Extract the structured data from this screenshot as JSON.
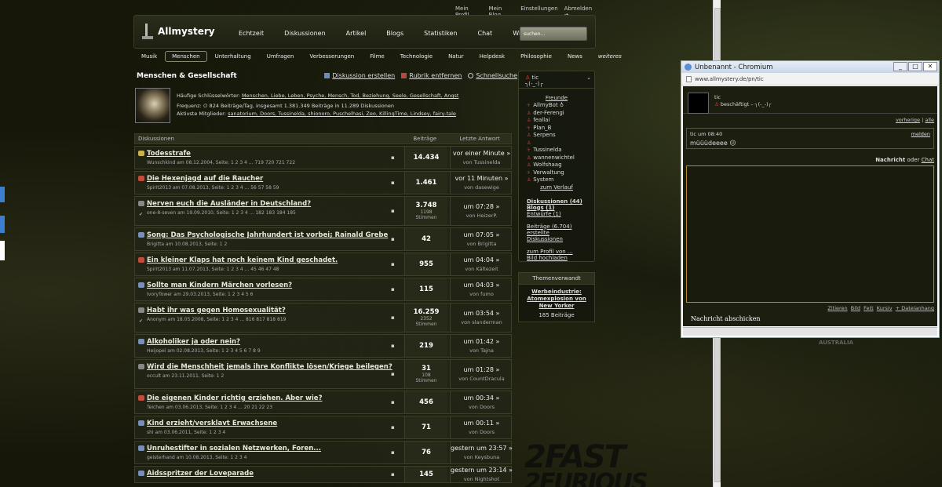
{
  "topnav": [
    "Mein Profil",
    "Mein Blog",
    "Einstellungen",
    "Abmelden ➔"
  ],
  "logo": "Allmystery",
  "mainnav": [
    "Echtzeit",
    "Diskussionen",
    "Artikel",
    "Blogs",
    "Statistiken",
    "Chat",
    "Wiki"
  ],
  "search_placeholder": "suchen...",
  "subnav": [
    "Musik",
    "Menschen",
    "Unterhaltung",
    "Umfragen",
    "Verbesserungen",
    "Filme",
    "Technologie",
    "Natur",
    "Helpdesk",
    "Philosophie",
    "News",
    "weiteres"
  ],
  "page": {
    "title": "Menschen & Gesellschaft",
    "action_create": "Diskussion erstellen",
    "action_remove": "Rubrik entfernen",
    "action_search": "Schnellsuche"
  },
  "info": {
    "keywords_label": "Häufige Schlüsselwörter:",
    "keywords": "Menschen, Liebe, Leben, Psyche, Mensch, Tod, Beziehung, Seele, Gesellschaft, Angst",
    "frequency": "Frequenz: ∅ 824 Beiträge/Tag, insgesamt 1.381.349 Beiträge in 11.289 Diskussionen",
    "members_label": "Aktivste Mitglieder:",
    "members": "sanatorium, Doors, Tussinelda, shionoro, Puschelhasi, Zeo, KillingTime, Lindsey, fairy-tale"
  },
  "table": {
    "col_discussions": "Diskussionen",
    "col_posts": "Beiträge",
    "col_last": "Letzte Antwort",
    "rows": [
      {
        "title": "Todesstrafe",
        "meta": "Wunschkind am 08.12.2004, Seite: 1 2 3 4 ... 719 720 721 722",
        "count": "14.434",
        "votes": "",
        "time": "vor einer Minute »",
        "by": "von Tussinelda",
        "icon": "yellow",
        "poll": false
      },
      {
        "title": "Die Hexenjagd auf die Raucher",
        "meta": "Spirit2013 am 07.08.2013, Seite: 1 2 3 4 ... 56 57 58 59",
        "count": "1.461",
        "votes": "",
        "time": "vor 11 Minuten »",
        "by": "von dasewige",
        "icon": "red",
        "poll": false
      },
      {
        "title": "Nerven euch die Ausländer in Deutschland?",
        "meta": "one-8-seven am 19.09.2010, Seite: 1 2 3 4 ... 182 183 184 185",
        "count": "3.748",
        "votes": "1198",
        "votes_label": "Stimmen",
        "time": "um 07:28 »",
        "by": "von HeizerP.",
        "icon": "poll",
        "poll": true
      },
      {
        "title": "Song: Das Psychologische Jahrhundert ist vorbei; Rainald Grebe",
        "meta": "Brigitta am 10.08.2013, Seite: 1 2",
        "count": "42",
        "votes": "",
        "time": "um 07:05 »",
        "by": "von Brigitta",
        "icon": "blue",
        "poll": false
      },
      {
        "title": "Ein kleiner Klaps hat noch keinem Kind geschadet.",
        "meta": "Spirit2013 am 11.07.2013, Seite: 1 2 3 4 ... 45 46 47 48",
        "count": "955",
        "votes": "",
        "time": "um 04:04 »",
        "by": "von Kältezeit",
        "icon": "red",
        "poll": false
      },
      {
        "title": "Sollte man Kindern Märchen vorlesen?",
        "meta": "IvoryTower am 29.03.2013, Seite: 1 2 3 4 5 6",
        "count": "115",
        "votes": "",
        "time": "um 04:03 »",
        "by": "von fumo",
        "icon": "blue",
        "poll": false
      },
      {
        "title": "Habt ihr was gegen Homosexualität?",
        "meta": "Anonym am 18.05.2008, Seite: 1 2 3 4 ... 816 817 818 819",
        "count": "16.259",
        "votes": "2352",
        "votes_label": "Stimmen",
        "time": "um 03:54 »",
        "by": "von slanderman",
        "icon": "poll",
        "poll": true
      },
      {
        "title": "Alkoholiker ja oder nein?",
        "meta": "Heijopei am 02.08.2013, Seite: 1 2 3 4 5 6 7 8 9",
        "count": "219",
        "votes": "",
        "time": "um 01:42 »",
        "by": "von Tajna",
        "icon": "blue",
        "poll": false
      },
      {
        "title": "Wird die Menschheit jemals ihre Konflikte lösen/Kriege beilegen?",
        "meta": "occult am 23.11.2011, Seite: 1 2",
        "count": "31",
        "votes": "108",
        "votes_label": "Stimmen",
        "time": "um 01:28 »",
        "by": "von CountDracula",
        "icon": "poll",
        "poll": false
      },
      {
        "title": "Die eigenen Kinder richtig erziehen. Aber wie?",
        "meta": "Teichen am 03.06.2013, Seite: 1 2 3 4 ... 20 21 22 23",
        "count": "456",
        "votes": "",
        "time": "um 00:34 »",
        "by": "von Doors",
        "icon": "red",
        "poll": false
      },
      {
        "title": "Kind erzieht/versklavt Erwachsene",
        "meta": "shi am 03.06.2011, Seite: 1 2 3 4",
        "count": "71",
        "votes": "",
        "time": "um 00:11 »",
        "by": "von Doors",
        "icon": "blue",
        "poll": false
      },
      {
        "title": "Unruhestifter in sozialen Netzwerken, Foren...",
        "meta": "geisterhand am 10.08.2013, Seite: 1 2 3 4",
        "count": "76",
        "votes": "",
        "time": "gestern um 23:57 »",
        "by": "von Keysbuna",
        "icon": "blue",
        "poll": false
      },
      {
        "title": "Aidsspritzer der Loveparade",
        "meta": "",
        "count": "145",
        "votes": "",
        "time": "gestern um 23:14 »",
        "by": "von Nightshot",
        "icon": "blue",
        "poll": false
      }
    ]
  },
  "side": {
    "user": "tic",
    "status": "┐(‐_‐)┌",
    "friends_title": "Freunde",
    "friends": [
      "AllmyBot ♁",
      "der-Ferengi",
      "feallai",
      "Plan_B",
      "Serpens",
      "",
      "Tussinelda",
      "wannenwichtel",
      "Wolfshaag",
      "Verwaltung",
      "System"
    ],
    "history": "zum Verlauf",
    "links1": [
      "Diskussionen (44)",
      "Blogs (1)",
      "Entwürfe (1)"
    ],
    "links2": [
      "Beiträge (6.704)",
      "erstellte Diskussionen"
    ],
    "links3": [
      "zum Profil von ...",
      "Bild hochladen"
    ]
  },
  "related": {
    "title": "Themenverwandt",
    "link": "Werbeindustrie: Atomexplosion von New Yorker",
    "count": "185 Beiträge"
  },
  "popup": {
    "title": "Unbenannt - Chromium",
    "url": "www.allmystery.de/pn/tic",
    "user": "tic",
    "status": "beschäftigt – ┐(‐_‐)┌",
    "nav_prev": "vorherige",
    "nav_all": "alle",
    "msg_time": "tic um 08:40",
    "msg_report": "melden",
    "msg_text": "müüüdeeee ☹",
    "compose_label": "Nachricht",
    "compose_or": "oder",
    "compose_chat": "Chat",
    "tools": [
      "Zitieren",
      "Bild",
      "Fett",
      "Kursiv",
      "+ Dateianhang"
    ],
    "send": "Nachricht abschicken"
  },
  "decor": {
    "movie": "2FAST",
    "movie2": "2FURIOUS",
    "map_label": "AUSTRALIA"
  }
}
